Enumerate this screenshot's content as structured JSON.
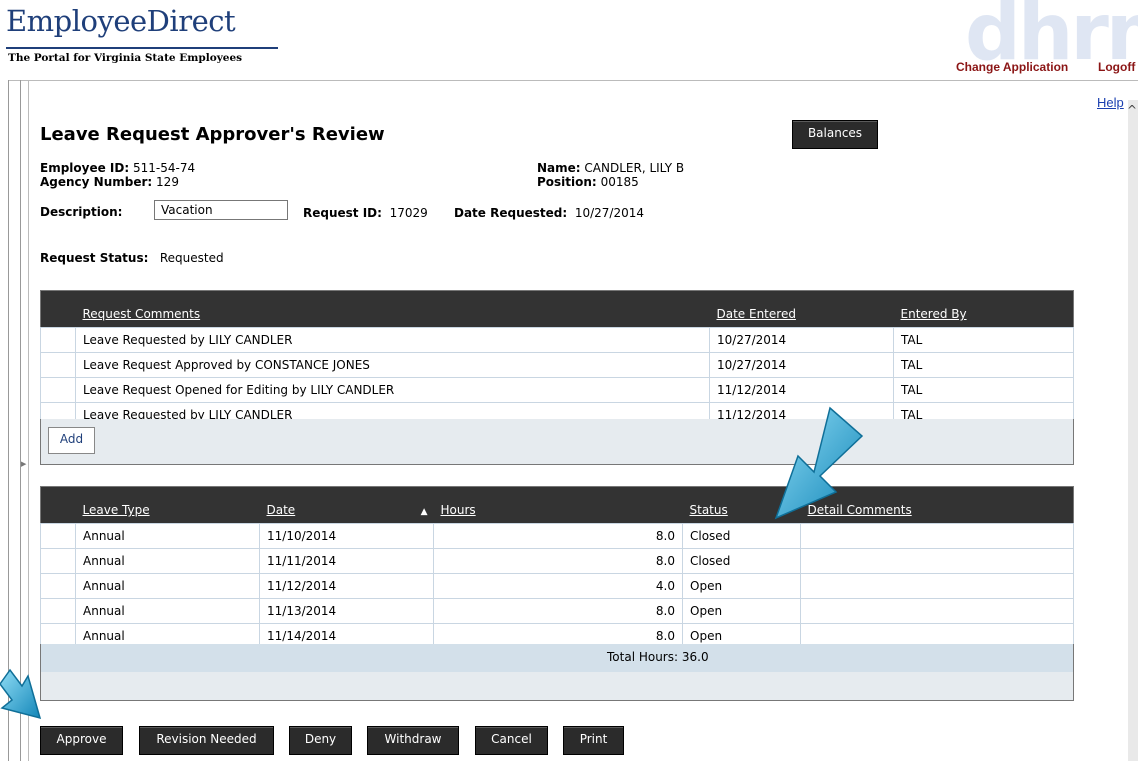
{
  "header": {
    "logo": "EmployeeDirect",
    "tagline": "The Portal for Virginia State Employees",
    "watermark": "dhrm",
    "change_application": "Change Application",
    "logoff": "Logoff"
  },
  "help": "Help",
  "page_title": "Leave Request Approver's Review",
  "balances_button": "Balances",
  "employee": {
    "id_label": "Employee ID:",
    "id": "511-54-74",
    "agency_label": "Agency Number:",
    "agency": "129",
    "name_label": "Name:",
    "name": "CANDLER, LILY B",
    "position_label": "Position:",
    "position": "00185"
  },
  "request": {
    "description_label": "Description:",
    "description": "Vacation",
    "request_id_label": "Request ID:",
    "request_id": "17029",
    "date_requested_label": "Date Requested:",
    "date_requested": "10/27/2014",
    "status_label": "Request Status:",
    "status": "Requested"
  },
  "comments_table": {
    "headers": [
      "Request Comments",
      "Date Entered",
      "Entered By"
    ],
    "rows": [
      {
        "comment": "Leave Requested by LILY CANDLER",
        "date": "10/27/2014",
        "by": "TAL"
      },
      {
        "comment": "Leave Request Approved by CONSTANCE JONES",
        "date": "10/27/2014",
        "by": "TAL"
      },
      {
        "comment": "Leave Request Opened for Editing by LILY CANDLER",
        "date": "11/12/2014",
        "by": "TAL"
      },
      {
        "comment": "Leave Requested by LILY CANDLER",
        "date": "11/12/2014",
        "by": "TAL"
      }
    ],
    "add_button": "Add"
  },
  "leave_table": {
    "headers": [
      "Leave Type",
      "Date",
      "Hours",
      "Status",
      "Detail Comments"
    ],
    "rows": [
      {
        "type": "Annual",
        "date": "11/10/2014",
        "hours": "8.0",
        "status": "Closed",
        "comments": ""
      },
      {
        "type": "Annual",
        "date": "11/11/2014",
        "hours": "8.0",
        "status": "Closed",
        "comments": ""
      },
      {
        "type": "Annual",
        "date": "11/12/2014",
        "hours": "4.0",
        "status": "Open",
        "comments": ""
      },
      {
        "type": "Annual",
        "date": "11/13/2014",
        "hours": "8.0",
        "status": "Open",
        "comments": ""
      },
      {
        "type": "Annual",
        "date": "11/14/2014",
        "hours": "8.0",
        "status": "Open",
        "comments": ""
      }
    ],
    "total": "Total Hours: 36.0"
  },
  "actions": {
    "approve": "Approve",
    "revision": "Revision Needed",
    "deny": "Deny",
    "withdraw": "Withdraw",
    "cancel": "Cancel",
    "print": "Print"
  },
  "colors": {
    "header_dark": "#333333",
    "link_red": "#8b1515",
    "brand_blue": "#1f3f7a",
    "pointer_arrow": "#29a3d6"
  }
}
